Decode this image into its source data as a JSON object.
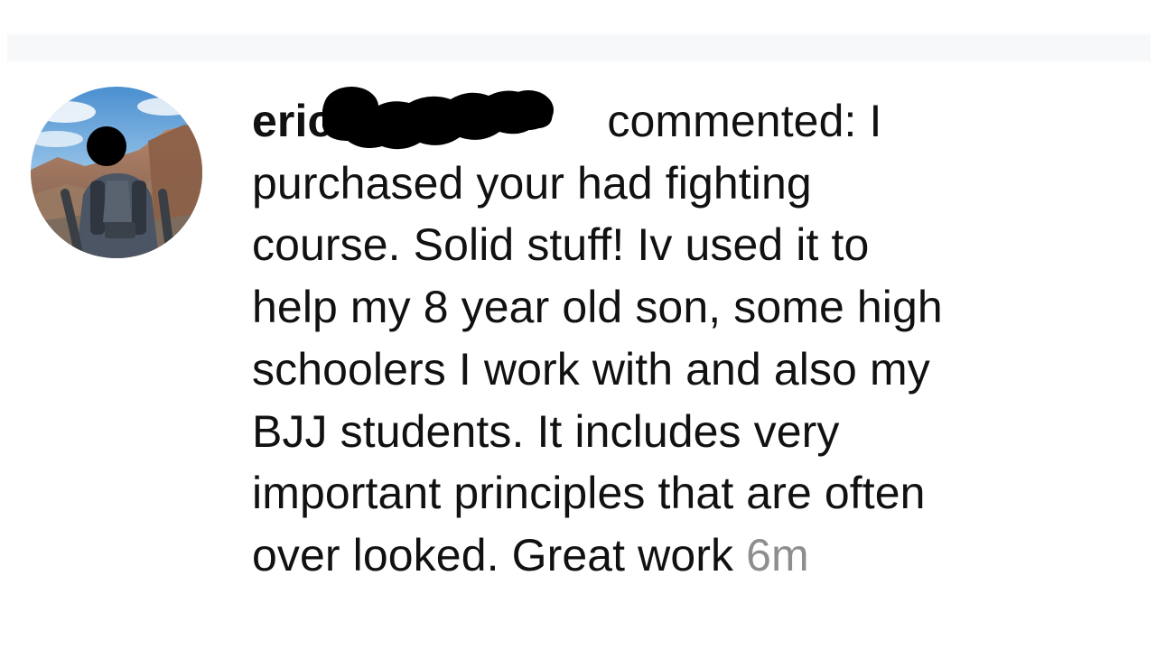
{
  "notification": {
    "username": "eric",
    "action": " commented: I",
    "lines": [
      "purchased your had fighting",
      "course. Solid stuff! Iv used it to",
      "help my 8 year old son, some high",
      "schoolers I work with and also my",
      "BJJ students. It includes very",
      "important principles that are often"
    ],
    "last_line": "over looked. Great work ",
    "timestamp": "6m"
  },
  "icons": {
    "avatar": "profile-photo-hiker",
    "redaction": "black-marker-redaction"
  },
  "colors": {
    "text": "#111111",
    "timestamp": "#8e8e8e",
    "top_band": "#f7f8f9",
    "redaction": "#000000"
  }
}
